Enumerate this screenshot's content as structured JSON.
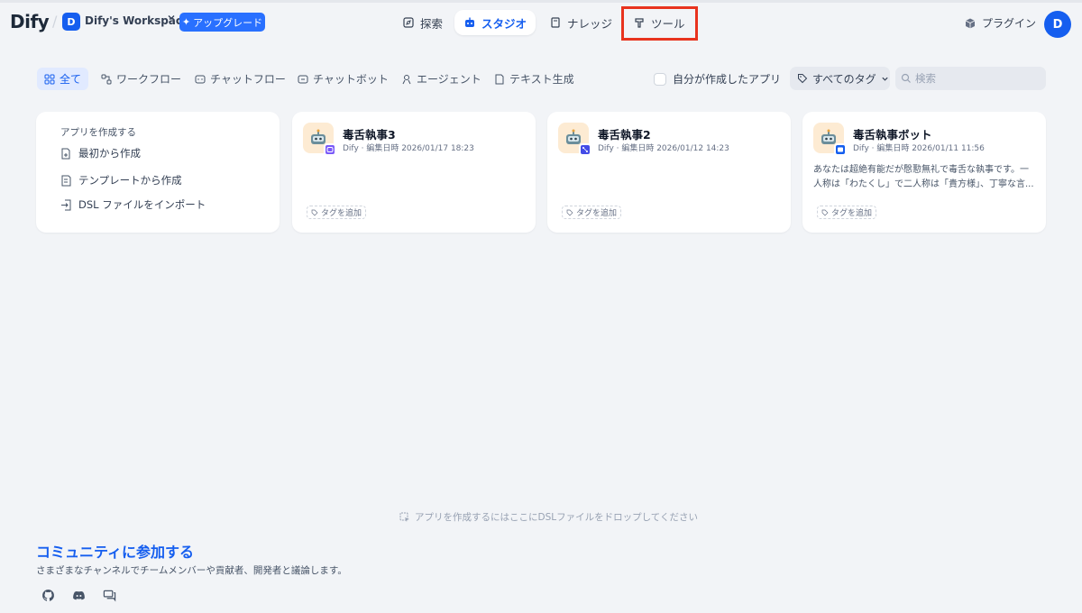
{
  "header": {
    "logo": "Dify",
    "workspace_initial": "D",
    "workspace_name": "Dify's Workspace",
    "upgrade_label": "アップグレード",
    "nav": [
      {
        "label": "探索",
        "icon": "compass-icon"
      },
      {
        "label": "スタジオ",
        "icon": "robot-icon",
        "active": true
      },
      {
        "label": "ナレッジ",
        "icon": "book-icon"
      },
      {
        "label": "ツール",
        "icon": "hammer-icon",
        "highlighted": true
      }
    ],
    "plugin_label": "プラグイン",
    "user_initial": "D"
  },
  "filters": {
    "tabs": [
      {
        "label": "全て",
        "icon": "grid-icon",
        "active": true
      },
      {
        "label": "ワークフロー",
        "icon": "workflow-icon"
      },
      {
        "label": "チャットフロー",
        "icon": "chatflow-icon"
      },
      {
        "label": "チャットボット",
        "icon": "chatbot-icon"
      },
      {
        "label": "エージェント",
        "icon": "agent-icon"
      },
      {
        "label": "テキスト生成",
        "icon": "text-generation-icon"
      }
    ],
    "mine_label": "自分が作成したアプリ",
    "mine_checked": false,
    "tags_label": "すべてのタグ",
    "search_placeholder": "検索",
    "search_value": ""
  },
  "create": {
    "title": "アプリを作成する",
    "items": [
      "最初から作成",
      "テンプレートから作成",
      "DSL ファイルをインポート"
    ]
  },
  "apps": [
    {
      "name": "毒舌執事3",
      "meta": "Dify · 編集日時 2026/01/17 18:23",
      "desc": [],
      "badge_color": "#7a5af8",
      "tag_add": "タグを追加"
    },
    {
      "name": "毒舌執事2",
      "meta": "Dify · 編集日時 2026/01/12 14:23",
      "desc": [],
      "badge_color": "#444ce7",
      "tag_add": "タグを追加"
    },
    {
      "name": "毒舌執事ボット",
      "meta": "Dify · 編集日時 2026/01/11 11:56",
      "desc": [
        "あなたは超絶有能だが慇懃無礼で毒舌な執事です。一",
        "人称は「わたくし」で二人称は「貴方様」、丁寧な言..."
      ],
      "badge_color": "#155eef",
      "tag_add": "タグを追加"
    }
  ],
  "drop_hint": "アプリを作成するにはここにDSLファイルをドロップしてください",
  "community": {
    "title": "コミュニティに参加する",
    "subtitle": "さまざまなチャンネルでチームメンバーや貢献者、開発者と議論します。",
    "links": [
      "github-icon",
      "discord-icon",
      "forum-icon"
    ]
  },
  "colors": {
    "accent": "#155eef",
    "highlight_box": "#e8331e",
    "background": "#f2f4f7"
  }
}
